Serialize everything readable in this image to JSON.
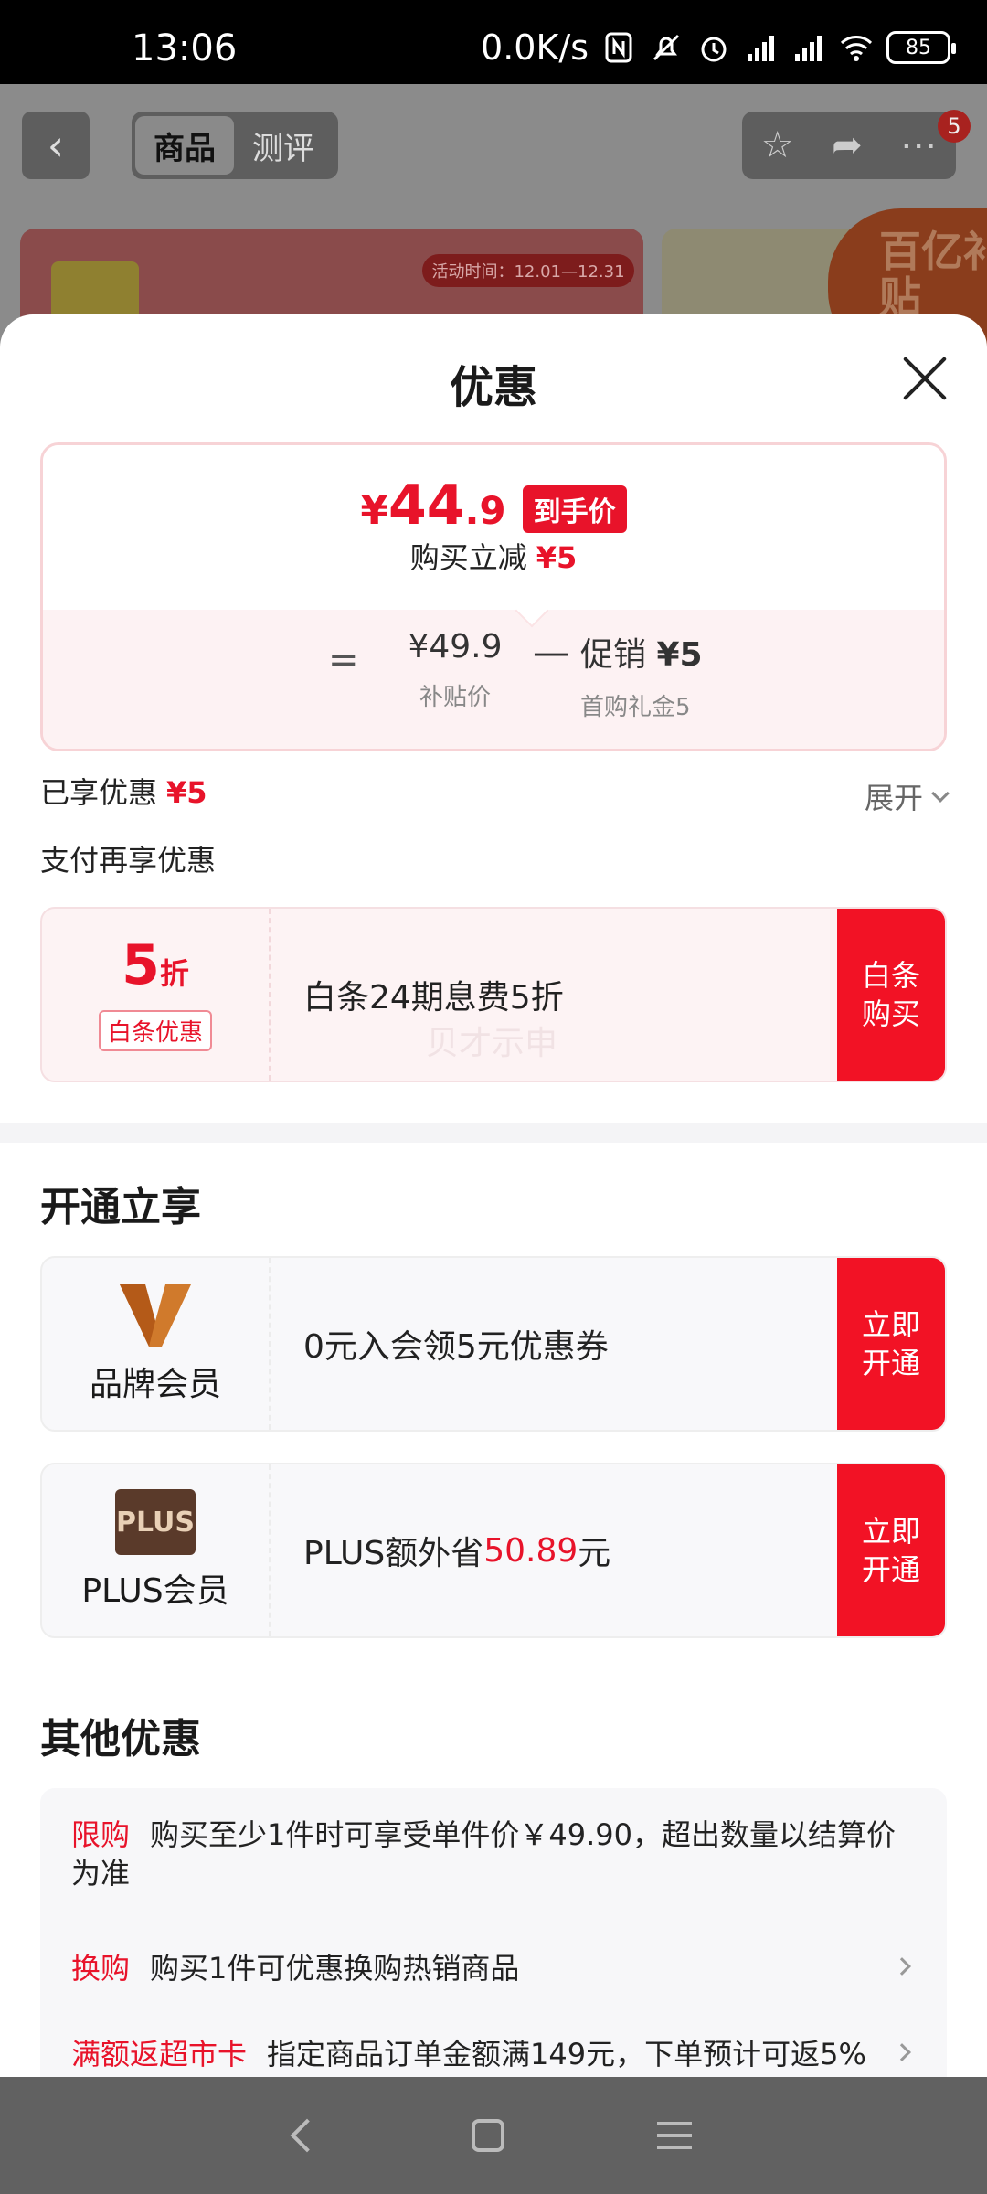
{
  "status_bar": {
    "time": "13:06",
    "net_speed": "0.0K/s",
    "battery": "85"
  },
  "background_page": {
    "tabs": [
      "商品",
      "测评"
    ],
    "badge_count": "5",
    "banner_activity": "活动时间：12.01—12.31",
    "subsidy_label": "百亿补贴"
  },
  "sheet": {
    "title": "优惠",
    "price_card": {
      "yen": "¥",
      "price_int": "44",
      "price_dec": ".9",
      "final_tag": "到手价",
      "reduce_text": "购买立减",
      "reduce_amount": "¥5",
      "equals": "=",
      "base_price": "¥49.9",
      "base_label": "补贴价",
      "minus": "—",
      "promo_label_a": "促销",
      "promo_amount": "¥5",
      "promo_desc": "首购礼金5"
    },
    "enjoyed_label": "已享优惠",
    "enjoyed_amount": "¥5",
    "expand_label": "展开",
    "pay_title": "支付再享优惠",
    "baitiao": {
      "discount_num": "5",
      "discount_unit": "折",
      "tag": "白条优惠",
      "text": "白条24期息费5折",
      "watermark": "贝才示申",
      "button": "白条购买"
    },
    "open_title": "开通立享",
    "brand_member": {
      "name": "品牌会员",
      "text": "0元入会领5元优惠券",
      "button": "立即开通"
    },
    "plus_member": {
      "logo": "PLUS",
      "name": "PLUS会员",
      "text_before": "PLUS额外省",
      "amount": "50.89",
      "text_after": "元",
      "button": "立即开通"
    },
    "other_title": "其他优惠",
    "other_items": [
      {
        "tag": "限购",
        "text": "购买至少1件时可享受单件价￥49.90，超出数量以结算价为准"
      },
      {
        "tag": "换购",
        "text": "购买1件可优惠换购热销商品"
      },
      {
        "tag": "满额返超市卡",
        "text": "指定商品订单金额满149元，下单预计可返5%"
      }
    ]
  },
  "colors": {
    "accent": "#e8132a",
    "button": "#f21225"
  }
}
